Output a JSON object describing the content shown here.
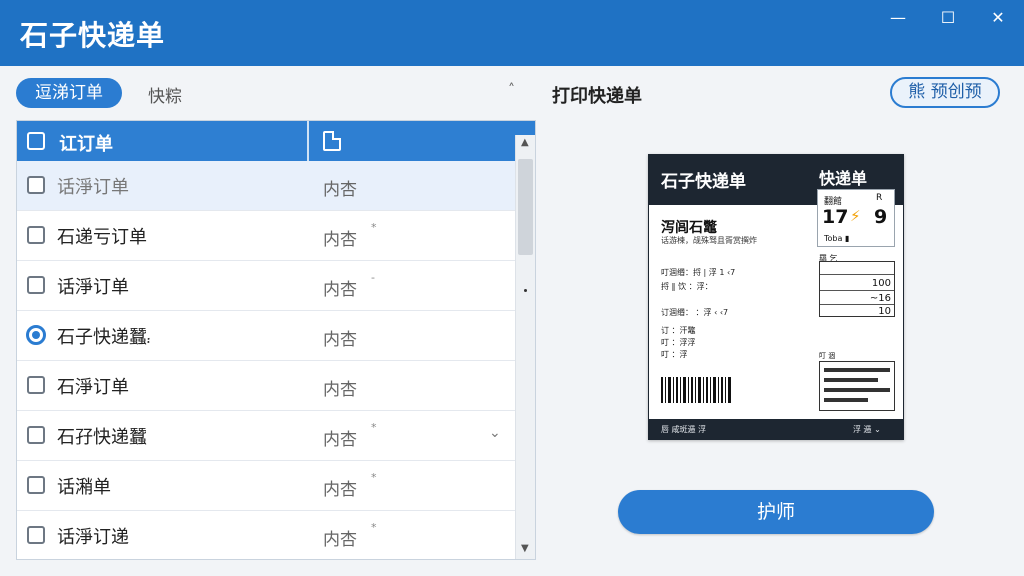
{
  "window": {
    "title": "石子快递单",
    "minimize_icon": "minimize-icon",
    "maximize_icon": "maximize-icon",
    "close_icon": "close-icon"
  },
  "left_panel": {
    "active_tab": "逗涕订单",
    "second_tab": "快粽",
    "collapse_glyph": "˄"
  },
  "table": {
    "header_label": "讧订单",
    "header_icon": "document-icon",
    "rows": [
      {
        "label": "话淨订单",
        "status": "内杏",
        "selected": true
      },
      {
        "label": "石递亏订单",
        "status": "内杏",
        "mark": "*"
      },
      {
        "label": "话淨订单",
        "status": "内杏",
        "mark": "-"
      },
      {
        "label": "石子快递蠶",
        "status": "内杏",
        "radio": true,
        "label_suffix": "᎓"
      },
      {
        "label": "石淨订单",
        "status": "内杏"
      },
      {
        "label": "石孖快递蠶",
        "status": "内杏",
        "mark": "*",
        "chevron": "⌄"
      },
      {
        "label": "话潲单",
        "status": "内杏",
        "mark": "*"
      },
      {
        "label": "话淨订递",
        "status": "内杏",
        "mark": "*"
      }
    ]
  },
  "right_panel": {
    "title": "打印快递单",
    "preview_button": "熊 预创预",
    "print_button": "护师"
  },
  "slip": {
    "brand": "石子快递单",
    "type": "快递单",
    "card_label": "翻館",
    "card_r": "R",
    "card_num_a": "17",
    "card_num_b": "9",
    "card_foot": "Toba   ▮",
    "name": "泻闾石鼈",
    "sub": "话游楝，觇殊驽且胥赏撰炸",
    "lines": [
      "叮涸缗：捋 | 浮 1 ‹7",
      "捋 ‖ 饮  ：浮：",
      "订涸缗： ：浮 ‹ ‹7",
      "订 ：汗鼈",
      "叮 ：浮浮",
      "叮 ：浮"
    ],
    "table_label": "羂 乞",
    "values": [
      "100",
      "~16",
      "10"
    ],
    "block_label": "叮 涸",
    "footer_left": "唇 咸斑逓 浮",
    "footer_right": "浮 逓 ⌄"
  },
  "colors": {
    "accent": "#1f72c4",
    "header_blue": "#2e7fd2",
    "dark": "#1d2631",
    "bolt": "#f2a20a"
  }
}
